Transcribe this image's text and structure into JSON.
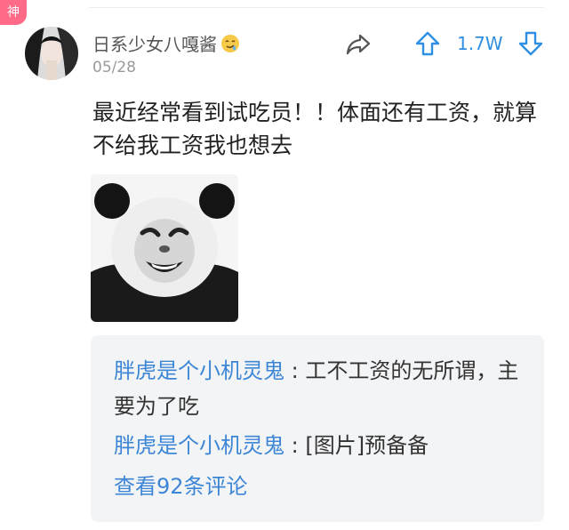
{
  "badge": {
    "label": "神"
  },
  "post": {
    "username": "日系少女八嘎酱",
    "date": "05/28",
    "vote_count": "1.7W",
    "text": "最近经常看到试吃员！！体面还有工资，就算不给我工资我也想去"
  },
  "comments": [
    {
      "user": "胖虎是个小机灵鬼",
      "separator": " : ",
      "text": "工不工资的无所谓，主要为了吃"
    },
    {
      "user": "胖虎是个小机灵鬼",
      "separator": " : ",
      "text": "[图片]预备备"
    }
  ],
  "view_more": "查看92条评论",
  "colors": {
    "accent": "#2f8fe3",
    "link": "#3d86d6",
    "badge": "#ff6a88"
  },
  "icons": [
    "share-icon",
    "upvote-icon",
    "downvote-icon",
    "drooling-emoji-icon"
  ]
}
